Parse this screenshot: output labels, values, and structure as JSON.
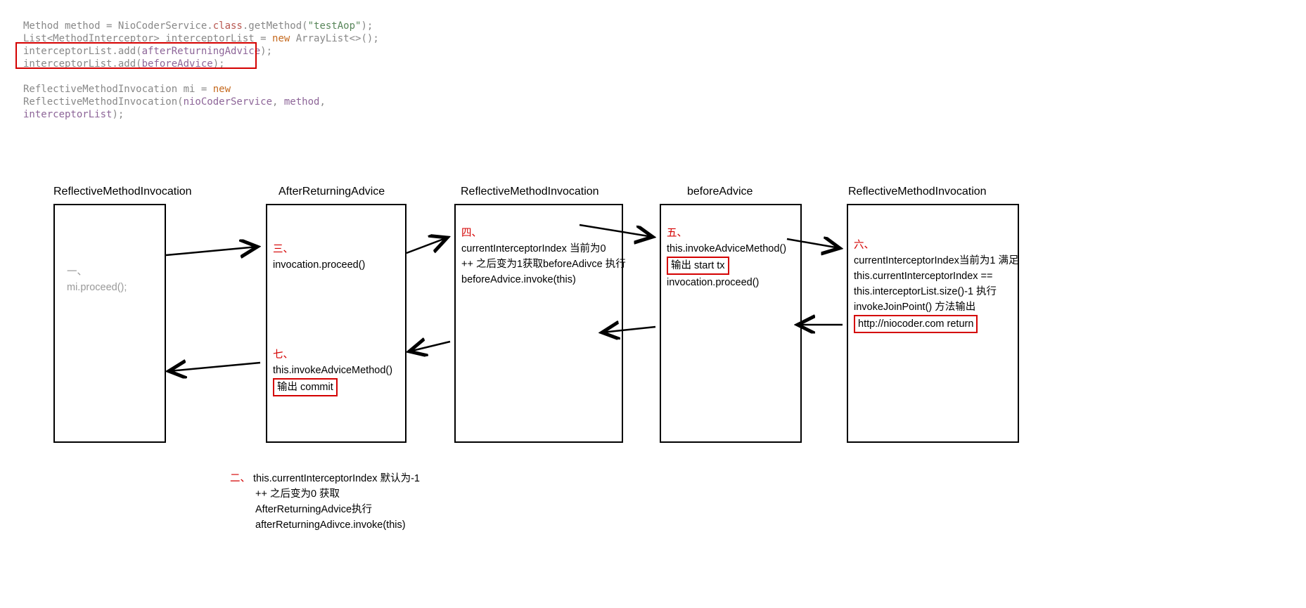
{
  "code": {
    "line1a": "Method method = NioCoderService.",
    "line1b": "class",
    "line1c": ".getMethod(",
    "line1d": "\"testAop\"",
    "line1e": ");",
    "line2a": "List<MethodInterceptor> interceptorList = ",
    "line2b": "new",
    "line2c": " ArrayList<>();",
    "line3a": "interceptorList.add(",
    "line3b": "afterReturningAdvice",
    "line3c": ");",
    "line4a": "interceptorList.add(",
    "line4b": "beforeAdvice",
    "line4c": ");",
    "line5a": "ReflectiveMethodInvocation mi = ",
    "line5b": "new",
    "line6a": "ReflectiveMethodInvocation(",
    "line6b": "nioCoderService",
    "line6c": ", ",
    "line6d": "method",
    "line6e": ",",
    "line7a": "interceptorList",
    "line7b": ");"
  },
  "titles": {
    "b1": "ReflectiveMethodInvocation",
    "b2": "AfterReturningAdvice",
    "b3": "ReflectiveMethodInvocation",
    "b4": "beforeAdvice",
    "b5": "ReflectiveMethodInvocation"
  },
  "box1": {
    "step": "一、",
    "line": "mi.proceed();"
  },
  "box2a": {
    "step": "三、",
    "line": "invocation.proceed()"
  },
  "box2b": {
    "step": "七、",
    "line1": "this.invokeAdviceMethod()",
    "out": "输出 commit"
  },
  "box3": {
    "step": "四、",
    "line1": "currentInterceptorIndex 当前为0",
    "line2": "++ 之后变为1获取beforeAdivce 执行",
    "line3": "beforeAdvice.invoke(this)"
  },
  "box4": {
    "step": "五、",
    "line1": "this.invokeAdviceMethod()",
    "out": "输出 start tx",
    "line2": "invocation.proceed()"
  },
  "box5": {
    "step": "六、",
    "line1": "currentInterceptorIndex当前为1 满足",
    "line2": "this.currentInterceptorIndex ==",
    "line3": "this.interceptorList.size()-1 执行",
    "line4": "invokeJoinPoint() 方法输出",
    "out": "http://niocoder.com  return"
  },
  "footnote": {
    "step": "二、",
    "line1": "this.currentInterceptorIndex 默认为-1",
    "line2": "++ 之后变为0 获取",
    "line3": "AfterReturningAdvice执行",
    "line4": "afterReturningAdivce.invoke(this)"
  }
}
